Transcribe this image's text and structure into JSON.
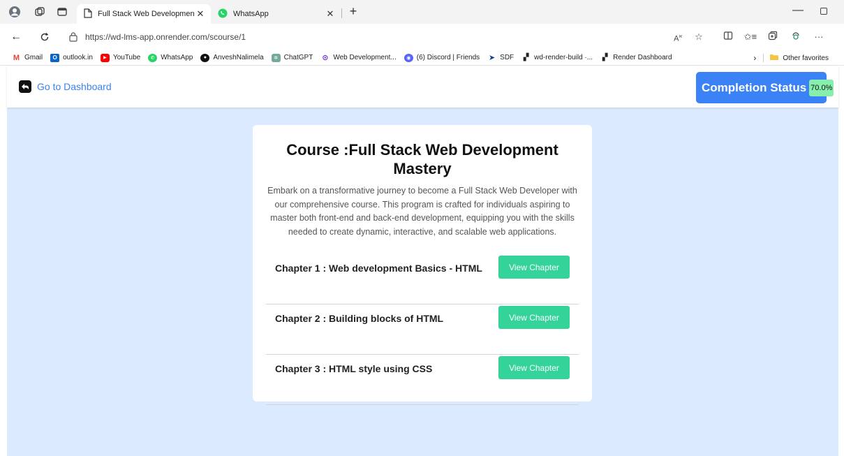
{
  "browser": {
    "tabs": [
      {
        "title": "Full Stack Web Development Ma",
        "icon": "page-icon",
        "active": true
      },
      {
        "title": "WhatsApp",
        "icon": "whatsapp-icon",
        "active": false
      }
    ],
    "url": "https://wd-lms-app.onrender.com/scourse/1",
    "bookmarks": [
      {
        "label": "Gmail",
        "icon": "gmail-icon"
      },
      {
        "label": "outlook.in",
        "icon": "outlook-icon"
      },
      {
        "label": "YouTube",
        "icon": "youtube-icon"
      },
      {
        "label": "WhatsApp",
        "icon": "whatsapp-icon"
      },
      {
        "label": "AnveshNalimela",
        "icon": "github-icon"
      },
      {
        "label": "ChatGPT",
        "icon": "chatgpt-icon"
      },
      {
        "label": "Web Development...",
        "icon": "web-dev-icon"
      },
      {
        "label": "(6) Discord | Friends",
        "icon": "discord-icon"
      },
      {
        "label": "SDF",
        "icon": "sdf-icon"
      },
      {
        "label": "wd-render-build ·...",
        "icon": "render-icon"
      },
      {
        "label": "Render Dashboard",
        "icon": "render-icon"
      }
    ],
    "other_favorites": "Other favorites",
    "colors": {
      "tabbar_bg": "#f3f3f3",
      "accent_green": "#25d366"
    }
  },
  "page": {
    "nav": {
      "dashboard_label": "Go to Dashboard",
      "completion_label": "Completion Status",
      "completion_value": "70.0%"
    },
    "course": {
      "title": "Course :Full Stack Web Development Mastery",
      "description": "Embark on a transformative journey to become a Full Stack Web Developer with our comprehensive course. This program is crafted for individuals aspiring to master both front-end and back-end development, equipping you with the skills needed to create dynamic, interactive, and scalable web applications."
    },
    "chapters": [
      {
        "title": "Chapter 1 : Web development Basics - HTML",
        "button": "View Chapter"
      },
      {
        "title": "Chapter 2 : Building blocks of HTML",
        "button": "View Chapter"
      },
      {
        "title": "Chapter 3 : HTML style using CSS",
        "button": "View Chapter"
      }
    ],
    "colors": {
      "page_bg": "#dbeafe",
      "link_blue": "#3b82f6",
      "status_bg": "#3b82f6",
      "badge_bg": "#86efac",
      "button_green": "#34d399"
    }
  }
}
